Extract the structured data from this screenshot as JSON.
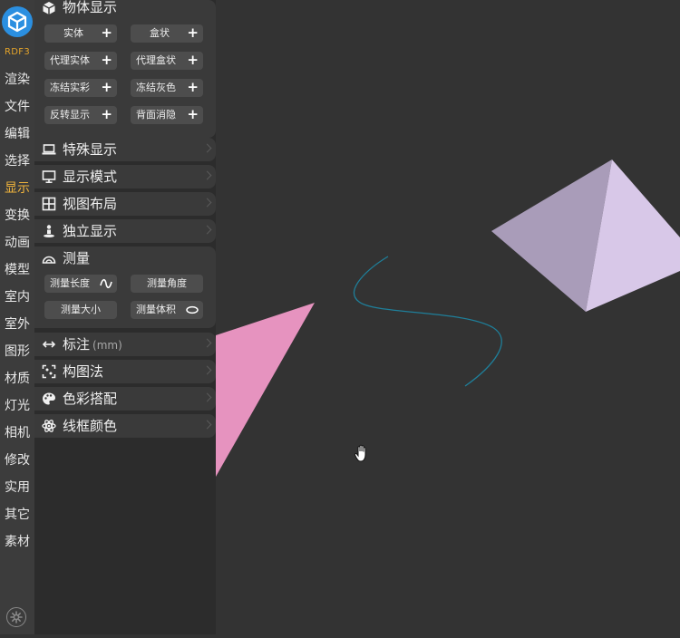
{
  "sidebar": {
    "brand": "RDF3",
    "items": [
      "渲染",
      "文件",
      "编辑",
      "选择",
      "显示",
      "变换",
      "动画",
      "模型",
      "室内",
      "室外",
      "图形",
      "材质",
      "灯光",
      "相机",
      "修改",
      "实用",
      "其它",
      "素材"
    ],
    "active_index": 4,
    "accent_color": "#f0b43c"
  },
  "panel": {
    "object_display": {
      "title": "物体显示",
      "buttons": [
        "实体",
        "盒状",
        "代理实体",
        "代理盒状",
        "冻结实彩",
        "冻结灰色",
        "反转显示",
        "背面消隐"
      ]
    },
    "special_display": {
      "title": "特殊显示"
    },
    "display_mode": {
      "title": "显示模式"
    },
    "view_layout": {
      "title": "视图布局"
    },
    "isolate_display": {
      "title": "独立显示"
    },
    "measure": {
      "title": "测量",
      "buttons": [
        "测量长度",
        "测量角度",
        "测量大小",
        "测量体积"
      ]
    },
    "annotation": {
      "title": "标注",
      "unit": "(mm)"
    },
    "composition": {
      "title": "构图法"
    },
    "color_scheme": {
      "title": "色彩搭配"
    },
    "wireframe_color": {
      "title": "线框颜色"
    }
  },
  "viewport": {
    "background": "#333333",
    "pyramid_light_color": "#d8c8e8",
    "pyramid_dark_color": "#a99cb9",
    "triangle_color": "#e693bf",
    "curve_color": "#1f7f9a",
    "cursor_icon": "hand-cursor-icon"
  }
}
